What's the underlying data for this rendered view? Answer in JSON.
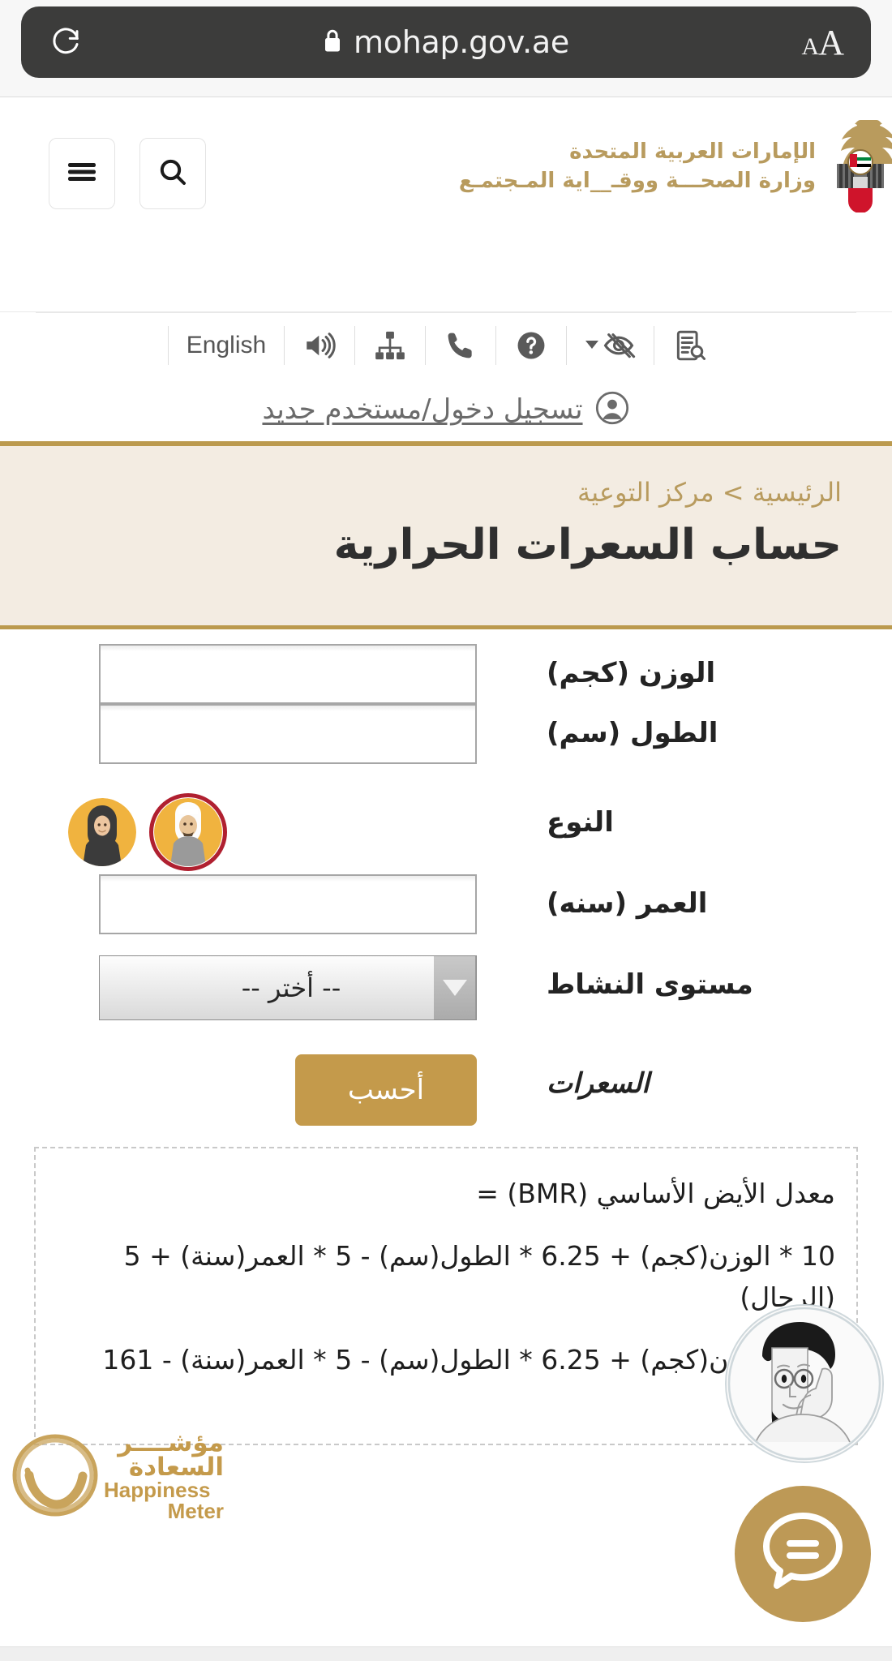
{
  "browser": {
    "url": "mohap.gov.ae",
    "reload_icon": "reload-icon",
    "lock_icon": "lock-icon",
    "text_size_small": "A",
    "text_size_big": "A"
  },
  "header": {
    "brand_line1": "الإمارات العربية المتحدة",
    "brand_line2": "وزارة الصحـــة ووقـ__اية المـجتمـع",
    "emblem_icon": "uae-falcon-emblem-icon",
    "search_icon": "search-icon",
    "menu_icon": "hamburger-menu-icon"
  },
  "utility_bar": {
    "language": "English",
    "items": [
      {
        "name": "language-switch",
        "label": "English"
      },
      {
        "name": "text-to-speech-icon",
        "label": ""
      },
      {
        "name": "sitemap-icon",
        "label": ""
      },
      {
        "name": "phone-icon",
        "label": ""
      },
      {
        "name": "help-icon",
        "label": ""
      },
      {
        "name": "accessibility-vision-icon",
        "label": ""
      },
      {
        "name": "read-document-icon",
        "label": ""
      }
    ]
  },
  "login": {
    "label": "تسجيل دخول/مستخدم جديد",
    "icon": "user-account-icon"
  },
  "banner": {
    "breadcrumb": "الرئيسية > مركز التوعية",
    "title": "حساب السعرات الحرارية"
  },
  "form": {
    "weight": {
      "label": "الوزن (كجم)",
      "value": "",
      "placeholder": ""
    },
    "height": {
      "label": "الطول (سم)",
      "value": "",
      "placeholder": ""
    },
    "gender": {
      "label": "النوع",
      "selected": "male",
      "options": [
        {
          "id": "female",
          "icon": "female-avatar-icon",
          "selected": false
        },
        {
          "id": "male",
          "icon": "male-avatar-icon",
          "selected": true
        }
      ]
    },
    "age": {
      "label": "العمر (سنه)",
      "value": "",
      "placeholder": ""
    },
    "activity": {
      "label": "مستوى النشاط",
      "selected_value": "-- أختر --",
      "caret_icon": "chevron-down-icon"
    },
    "calories": {
      "label": "السعرات",
      "button_label": "أحسب"
    }
  },
  "formula": {
    "line1": "معدل الأيض الأساسي (BMR) =",
    "line2": "10 * الوزن(كجم) + 6.25 * الطول(سم) - 5 * العمر(سنة) + 5 (الرجال)",
    "line3": "10 * الوزن(كجم) + 6.25 * الطول(سم) - 5 * العمر(سنة) - 161 (النساء)"
  },
  "widgets": {
    "happiness_meter": {
      "arabic": "مؤشــــر السعادة",
      "english_line1": "Happiness",
      "english_line2": "Meter",
      "icon": "happiness-smiley-icon"
    },
    "helper_avatar_icon": "helper-character-avatar-icon",
    "chat_button_icon": "chat-bubble-icon"
  },
  "colors": {
    "gold": "#bb9a4e",
    "banner_bg": "#f3ece2",
    "button_gold": "#c49a4b",
    "selected_ring": "#b02030",
    "chrome_dark": "#3c3c3b"
  }
}
